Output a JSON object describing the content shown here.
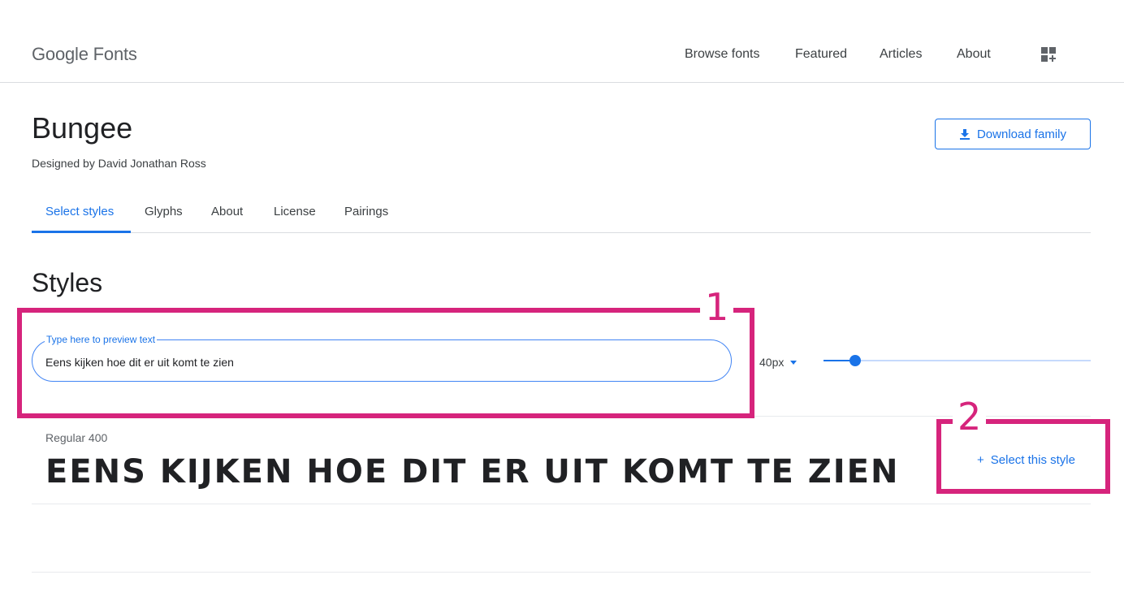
{
  "header": {
    "logo_google": "Google",
    "logo_fonts": "Fonts",
    "nav": {
      "browse": "Browse fonts",
      "featured": "Featured",
      "articles": "Articles",
      "about": "About"
    }
  },
  "font": {
    "name": "Bungee",
    "designer": "Designed by David Jonathan Ross",
    "download_label": "Download family"
  },
  "tabs": {
    "select_styles": "Select styles",
    "glyphs": "Glyphs",
    "about": "About",
    "license": "License",
    "pairings": "Pairings"
  },
  "styles": {
    "heading": "Styles",
    "preview_label": "Type here to preview text",
    "preview_value": "Eens kijken hoe dit er uit komt te zien",
    "size_value": "40px",
    "slider_fraction": 0.12,
    "items": [
      {
        "name": "Regular 400",
        "sample": "Eens kijken hoe dit er uit komt te zien",
        "select_label": "Select this style"
      }
    ]
  },
  "annotations": {
    "one": "1",
    "two": "2"
  },
  "colors": {
    "accent": "#1a73e8",
    "annotation": "#d6247c"
  }
}
